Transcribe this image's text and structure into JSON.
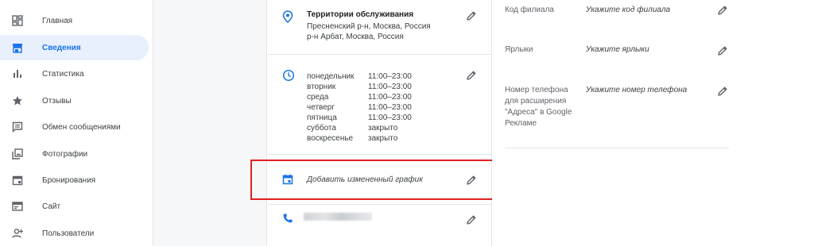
{
  "sidebar": {
    "items": [
      {
        "label": "Главная",
        "icon": "dashboard-icon"
      },
      {
        "label": "Сведения",
        "icon": "storefront-icon",
        "active": true
      },
      {
        "label": "Статистика",
        "icon": "bar-chart-icon"
      },
      {
        "label": "Отзывы",
        "icon": "star-icon"
      },
      {
        "label": "Обмен сообщениями",
        "icon": "message-icon"
      },
      {
        "label": "Фотографии",
        "icon": "photo-library-icon"
      },
      {
        "label": "Бронирования",
        "icon": "calendar-icon"
      },
      {
        "label": "Сайт",
        "icon": "web-icon"
      },
      {
        "label": "Пользователи",
        "icon": "person-add-icon"
      }
    ]
  },
  "service_area": {
    "title": "Территории обслуживания",
    "lines": [
      "Пресненский р-н, Москва, Россия",
      "р-н Арбат, Москва, Россия"
    ]
  },
  "hours": [
    {
      "day": "понедельник",
      "time": "11:00–23:00"
    },
    {
      "day": "вторник",
      "time": "11:00–23:00"
    },
    {
      "day": "среда",
      "time": "11:00–23:00"
    },
    {
      "day": "четверг",
      "time": "11:00–23:00"
    },
    {
      "day": "пятница",
      "time": "11:00–23:00"
    },
    {
      "day": "суббота",
      "time": "закрыто"
    },
    {
      "day": "воскресенье",
      "time": "закрыто"
    }
  ],
  "special_hours": {
    "label": "Добавить измененный график"
  },
  "right": {
    "branch_code": {
      "label": "Код филиала",
      "value": "Укажите код филиала"
    },
    "labels": {
      "label": "Ярлыки",
      "value": "Укажите ярлыки"
    },
    "phone_ext": {
      "label_lines": [
        "Номер телефона",
        "для расширения",
        "\"Адреса\" в Google",
        "Рекламе"
      ],
      "value": "Укажите номер телефона"
    }
  },
  "colors": {
    "accent": "#1a73e8",
    "highlight": "#e02020",
    "icon_gray": "#5f6368"
  }
}
